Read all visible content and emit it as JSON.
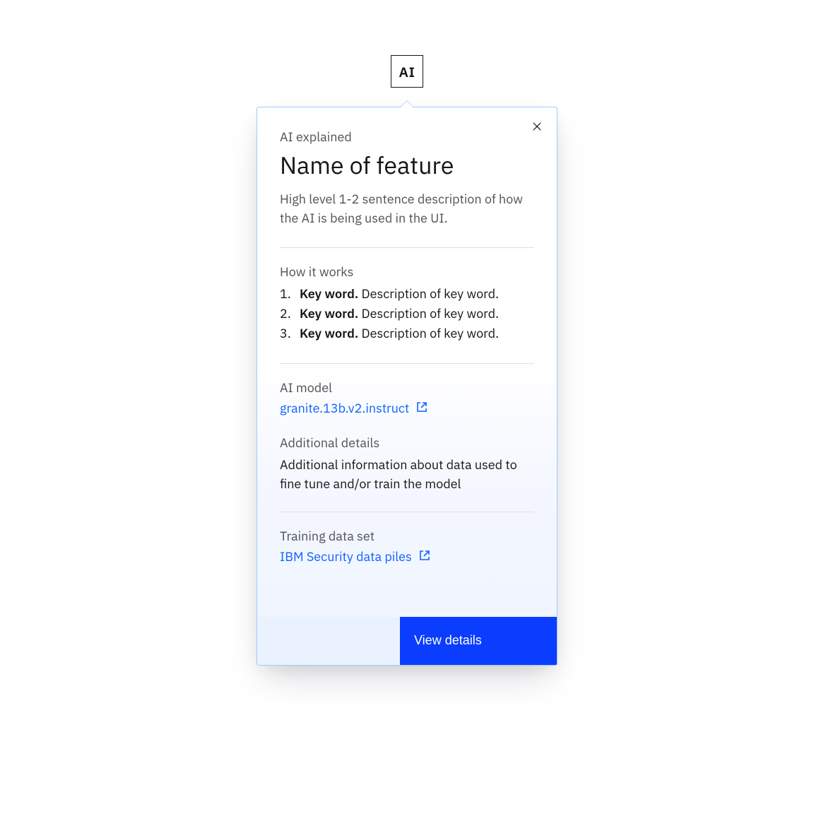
{
  "badge": "AI",
  "popover": {
    "eyebrow": "AI explained",
    "title": "Name of feature",
    "description": "High level 1-2 sentence description of how the AI is being used in the UI.",
    "how_it_works": {
      "label": "How it works",
      "items": [
        {
          "key": "Key word.",
          "desc": "Description of key word."
        },
        {
          "key": "Key word.",
          "desc": "Description of key word."
        },
        {
          "key": "Key word.",
          "desc": "Description of key word."
        }
      ]
    },
    "ai_model": {
      "label": "AI model",
      "link_text": "granite.13b.v2.instruct"
    },
    "additional_details": {
      "label": "Additional details",
      "text": "Additional information about data used to fine tune and/or train the model"
    },
    "training_data": {
      "label": "Training data set",
      "link_text": "IBM Security data piles"
    },
    "footer_button": "View details"
  },
  "colors": {
    "link": "#0f62fe",
    "text": "#161616",
    "muted": "#525252",
    "border": "#a6c8ff",
    "primary": "#0b3dff"
  }
}
